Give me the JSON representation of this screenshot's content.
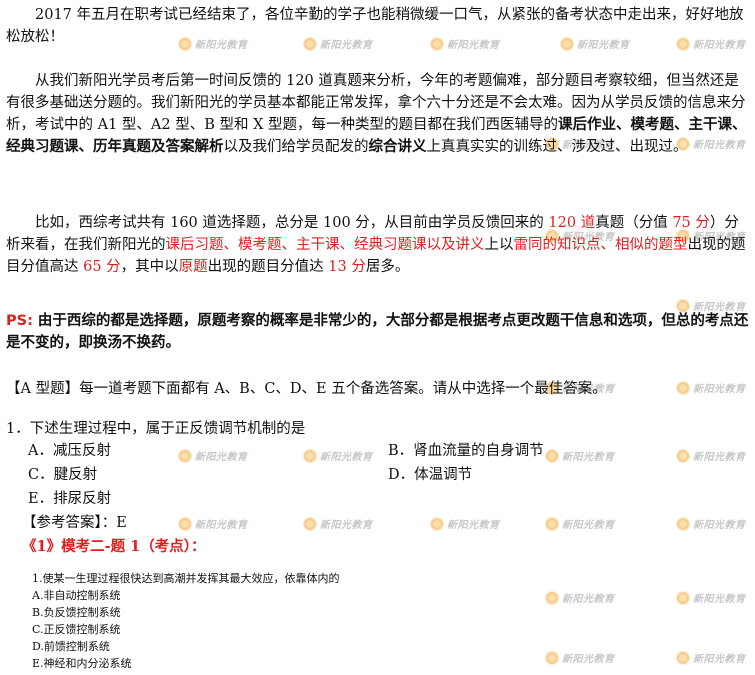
{
  "watermark": {
    "text": "新阳光教育"
  },
  "intro": {
    "p1": "2017 年五月在职考试已经结束了，各位辛勤的学子也能稍微缓一口气，从紧张的备考状态中走出来，好好地放松放松！",
    "p2": [
      {
        "t": "从我们新阳光学员考后第一时间反馈的 120 道真题来分析，今年的考题偏难，部分题目考察较细，但当然还是有很多基础送分题的。我们新阳光的学员基本都能正常发挥，拿个六十分还是不会太难。因为从学员反馈的信息来分析，考试中的 A1 型、A2 型、B 型和 X 型题，每一种类型的题目都在我们西医辅导的",
        "s": ""
      },
      {
        "t": "课后作业、模考题、主干课、经典习题课、历年真题及答案解析",
        "s": "b"
      },
      {
        "t": "以及我们给学员配发的",
        "s": ""
      },
      {
        "t": "综合讲义",
        "s": "b"
      },
      {
        "t": "上真真实实的训练过、涉及过、出现过。",
        "s": ""
      }
    ],
    "p3": [
      {
        "t": "比如，西综考试共有 160 道选择题，总分是 100 分，从目前由学员反馈回来的 ",
        "s": ""
      },
      {
        "t": "120 道",
        "s": "r"
      },
      {
        "t": "真题（分值 ",
        "s": ""
      },
      {
        "t": "75 分",
        "s": "r"
      },
      {
        "t": "）分析来看，在我们新阳光的",
        "s": ""
      },
      {
        "t": "课后习题、模考题、主干课、经典习题课以及讲义",
        "s": "r"
      },
      {
        "t": "上以",
        "s": ""
      },
      {
        "t": "雷同的知识点、相似的题型",
        "s": "r"
      },
      {
        "t": "出现的题目分值高达 ",
        "s": ""
      },
      {
        "t": "65 分",
        "s": "r"
      },
      {
        "t": "，其中以",
        "s": ""
      },
      {
        "t": "原题",
        "s": "r"
      },
      {
        "t": "出现的题目分值达 ",
        "s": ""
      },
      {
        "t": "13 分",
        "s": "r"
      },
      {
        "t": "居多。",
        "s": ""
      }
    ],
    "ps_label": "PS:",
    "ps_text": " 由于西综的都是选择题，原题考察的概率是非常少的，大部分都是根据考点更改题干信息和选项，但总的考点还是不变的，即换汤不换药。"
  },
  "section": {
    "type_header": "【A 型题】每一道考题下面都有 A、B、C、D、E 五个备选答案。请从中选择一个最佳答案。",
    "q1": "1．下述生理过程中，属于正反馈调节机制的是",
    "options": {
      "A": "A．减压反射",
      "B": "B．肾血流量的自身调节",
      "C": "C．腱反射",
      "D": "D．体温调节",
      "E": "E．排尿反射"
    },
    "answer_label": "【参考答案】：",
    "answer_value": "E",
    "source": "《1》模考二-题 1（考点）：",
    "mock": {
      "question": "1.使某一生理过程很快达到高潮并发挥其最大效应，依靠体内的",
      "A": "A.非自动控制系统",
      "B": "B.负反馈控制系统",
      "C": "C.正反馈控制系统",
      "D": "D.前馈控制系统",
      "E": "E.神经和内分泌系统"
    }
  }
}
